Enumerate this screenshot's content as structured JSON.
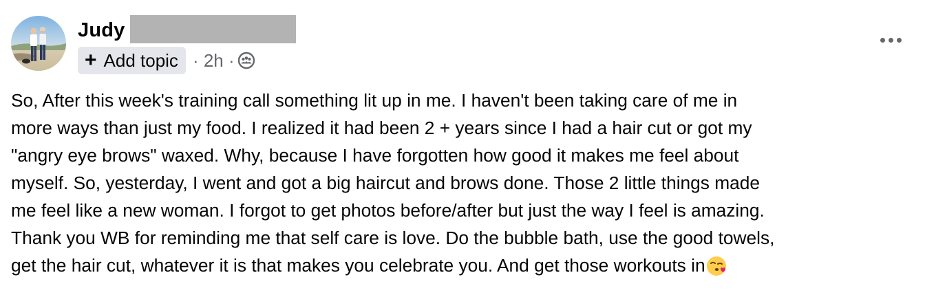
{
  "post": {
    "author_name": "Judy",
    "add_topic_label": "Add topic",
    "meta_timestamp": "· 2h ·",
    "audience": "group-members-icon",
    "body_lines": [
      "So, After this week's training call something lit up in me. I haven't been taking care of me in",
      "more ways than just my food. I realized it had been 2 + years since I had a hair cut or got my",
      "\"angry eye brows\" waxed. Why, because I have forgotten how good it makes me feel about",
      "myself. So, yesterday, I went and got a big haircut and brows done. Those 2 little things made",
      "me feel like a new woman. I forgot to get photos before/after but just the way I feel is amazing.",
      "Thank you WB for reminding me that self care is love. Do the bubble bath, use the good towels,",
      "get the hair cut, whatever it is that makes you celebrate you. And  get those workouts in"
    ],
    "trailing_emoji": "face-blowing-kiss-icon"
  },
  "icons": {
    "add": "plus-icon",
    "more": "more-options-icon"
  },
  "colors": {
    "text_primary": "#050505",
    "text_secondary": "#65676b",
    "chip_background": "#e4e6eb",
    "redaction": "#b3b3b3"
  }
}
